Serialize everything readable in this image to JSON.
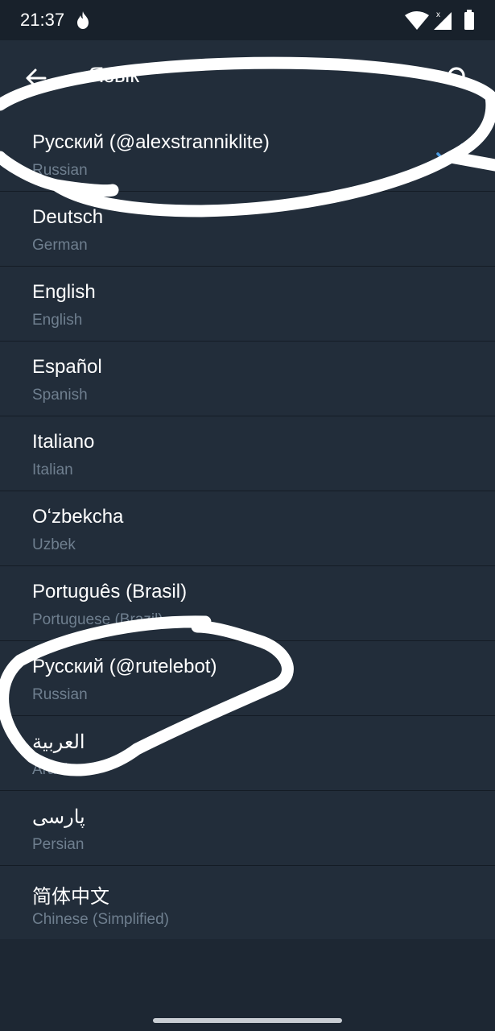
{
  "status_bar": {
    "time": "21:37",
    "icons": [
      "flame-icon",
      "wifi-icon",
      "signal-icon",
      "battery-icon"
    ]
  },
  "app_bar": {
    "title": "Язык",
    "back_icon": "arrow-left-icon",
    "search_icon": "search-icon"
  },
  "languages": [
    {
      "name": "Русский (@alexstranniklite)",
      "subtitle": "Russian",
      "selected": true
    },
    {
      "name": "Deutsch",
      "subtitle": "German",
      "selected": false
    },
    {
      "name": "English",
      "subtitle": "English",
      "selected": false
    },
    {
      "name": "Español",
      "subtitle": "Spanish",
      "selected": false
    },
    {
      "name": "Italiano",
      "subtitle": "Italian",
      "selected": false
    },
    {
      "name": "Oʻzbekcha",
      "subtitle": "Uzbek",
      "selected": false
    },
    {
      "name": "Português (Brasil)",
      "subtitle": "Portuguese (Brazil)",
      "selected": false
    },
    {
      "name": "Русский (@rutelebot)",
      "subtitle": "Russian",
      "selected": false
    },
    {
      "name": "العربية",
      "subtitle": "Arabic",
      "selected": false
    },
    {
      "name": "پارسی",
      "subtitle": "Persian",
      "selected": false
    },
    {
      "name": "简体中文",
      "subtitle": "Chinese (Simplified)",
      "selected": false
    }
  ],
  "colors": {
    "background": "#1d2733",
    "surface": "#222d3a",
    "accent": "#4c9ce2",
    "subtitle": "#6f7f8f",
    "annotation": "#ffffff"
  }
}
